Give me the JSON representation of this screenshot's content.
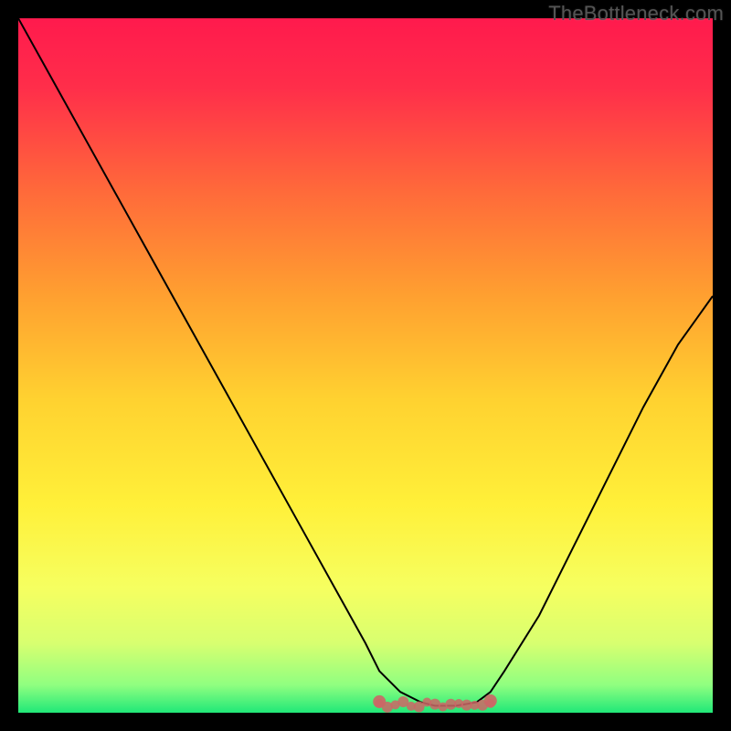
{
  "watermark": "TheBottleneck.com",
  "chart_data": {
    "type": "line",
    "title": "",
    "xlabel": "",
    "ylabel": "",
    "xlim": [
      0,
      100
    ],
    "ylim": [
      0,
      100
    ],
    "grid": false,
    "series": [
      {
        "name": "bottleneck-curve",
        "color": "#000000",
        "x": [
          0,
          5,
          10,
          15,
          20,
          25,
          30,
          35,
          40,
          45,
          50,
          52,
          55,
          58,
          60,
          63,
          66,
          68,
          70,
          75,
          80,
          85,
          90,
          95,
          100
        ],
        "y": [
          100,
          91,
          82,
          73,
          64,
          55,
          46,
          37,
          28,
          19,
          10,
          6,
          3,
          1.5,
          1,
          1,
          1.5,
          3,
          6,
          14,
          24,
          34,
          44,
          53,
          60
        ]
      }
    ],
    "annotations": [
      {
        "name": "optimal-zone-marker",
        "type": "scatter-band",
        "color": "#cc6666",
        "x_range": [
          52,
          68
        ],
        "y": 1.2
      }
    ],
    "background_gradient": {
      "stops": [
        {
          "offset": 0.0,
          "color": "#ff1a4d"
        },
        {
          "offset": 0.1,
          "color": "#ff2e4a"
        },
        {
          "offset": 0.25,
          "color": "#ff6a3a"
        },
        {
          "offset": 0.4,
          "color": "#ffa030"
        },
        {
          "offset": 0.55,
          "color": "#ffd230"
        },
        {
          "offset": 0.7,
          "color": "#fff039"
        },
        {
          "offset": 0.82,
          "color": "#f6ff60"
        },
        {
          "offset": 0.9,
          "color": "#d8ff70"
        },
        {
          "offset": 0.96,
          "color": "#90ff80"
        },
        {
          "offset": 1.0,
          "color": "#20e878"
        }
      ]
    }
  }
}
